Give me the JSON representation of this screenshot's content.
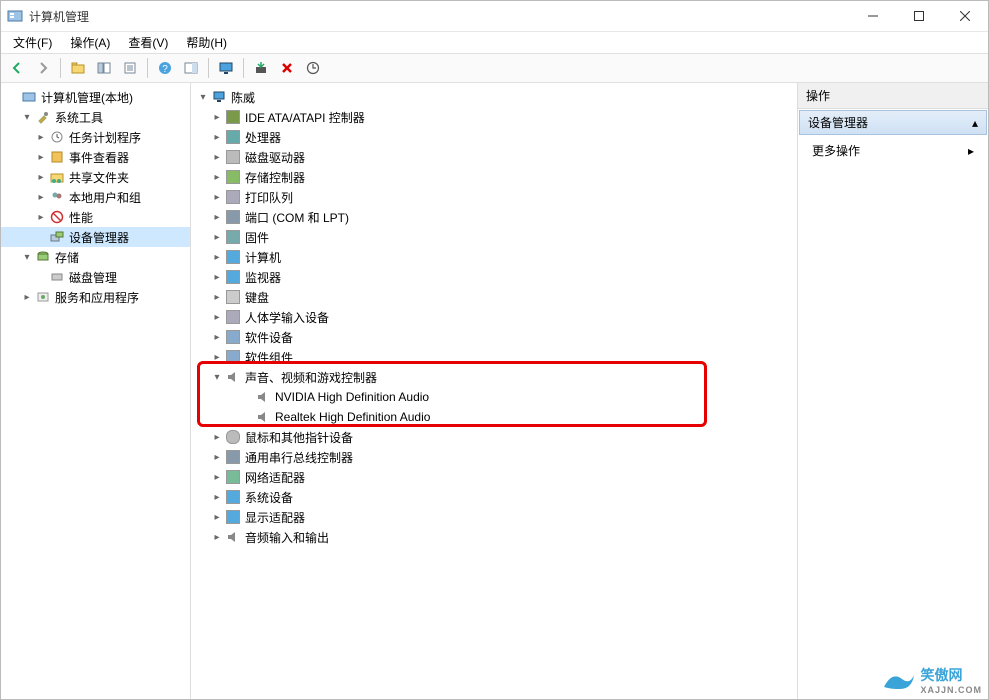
{
  "title": "计算机管理",
  "menus": {
    "file": "文件(F)",
    "action": "操作(A)",
    "view": "查看(V)",
    "help": "帮助(H)"
  },
  "left_tree": {
    "root": "计算机管理(本地)",
    "system_tools": "系统工具",
    "task_scheduler": "任务计划程序",
    "event_viewer": "事件查看器",
    "shared_folders": "共享文件夹",
    "local_users": "本地用户和组",
    "performance": "性能",
    "device_manager": "设备管理器",
    "storage": "存储",
    "disk_mgmt": "磁盘管理",
    "services": "服务和应用程序"
  },
  "devices": {
    "root": "陈威",
    "ide": "IDE ATA/ATAPI 控制器",
    "cpu": "处理器",
    "disk": "磁盘驱动器",
    "storage": "存储控制器",
    "print": "打印队列",
    "ports": "端口 (COM 和 LPT)",
    "firmware": "固件",
    "computer": "计算机",
    "monitor": "监视器",
    "keyboard": "键盘",
    "hid": "人体学输入设备",
    "softdev": "软件设备",
    "softcomp": "软件组件",
    "sound": "声音、视频和游戏控制器",
    "sound_nvidia": "NVIDIA High Definition Audio",
    "sound_realtek": "Realtek High Definition Audio",
    "mouse": "鼠标和其他指针设备",
    "usb": "通用串行总线控制器",
    "net": "网络适配器",
    "sysdev": "系统设备",
    "display": "显示适配器",
    "audio_io": "音频输入和输出"
  },
  "right": {
    "header": "操作",
    "section": "设备管理器",
    "more": "更多操作"
  },
  "watermark": {
    "main": "笑傲网",
    "sub": "XAJJN.COM"
  }
}
